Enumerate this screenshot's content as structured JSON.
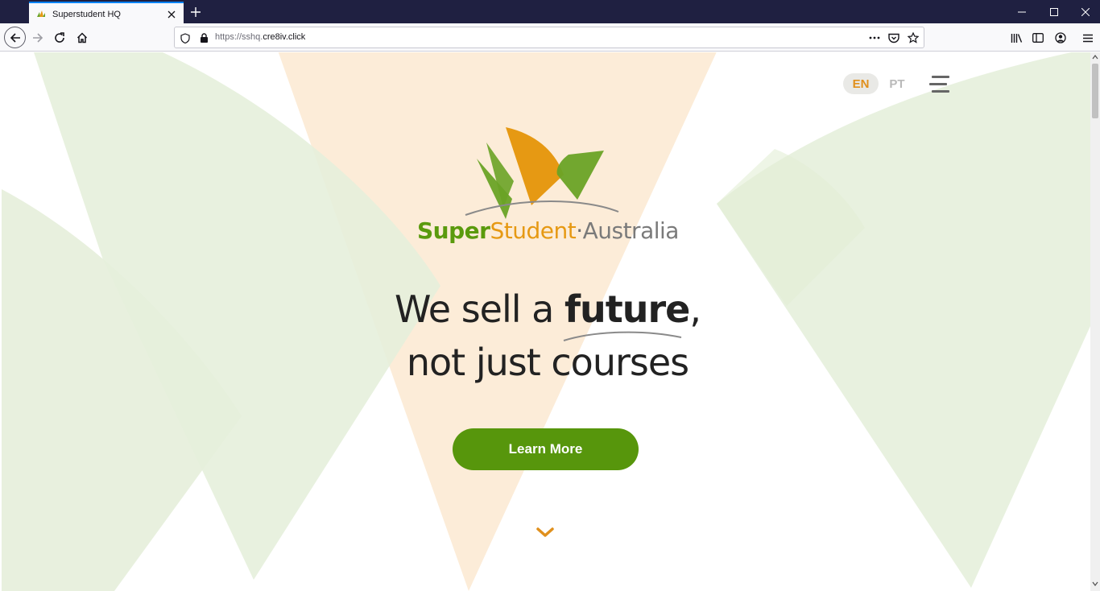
{
  "browser": {
    "tab_title": "Superstudent HQ",
    "url_prefix": "https://sshq.",
    "url_domain": "cre8iv.click",
    "icons": [
      "favicon-icon",
      "close-icon",
      "plus-icon",
      "minimize-icon",
      "maximize-icon",
      "close-window-icon",
      "back-icon",
      "forward-icon",
      "reload-icon",
      "home-icon",
      "shield-icon",
      "lock-icon",
      "more-icon",
      "pocket-icon",
      "star-icon",
      "library-icon",
      "sidebar-icon",
      "account-icon",
      "menu-icon"
    ]
  },
  "page": {
    "lang_en": "EN",
    "lang_pt": "PT",
    "brand_super": "Super",
    "brand_student": "Student",
    "brand_dot": "·",
    "brand_australia": "Australia",
    "headline_pre": "We sell a ",
    "headline_bold": "future",
    "headline_comma": ",",
    "headline_line2": "not just courses",
    "cta_label": "Learn More",
    "colors": {
      "green": "#57960c",
      "orange": "#e69913",
      "light_green": "#e9f1de",
      "light_orange": "#fcecd8"
    }
  }
}
